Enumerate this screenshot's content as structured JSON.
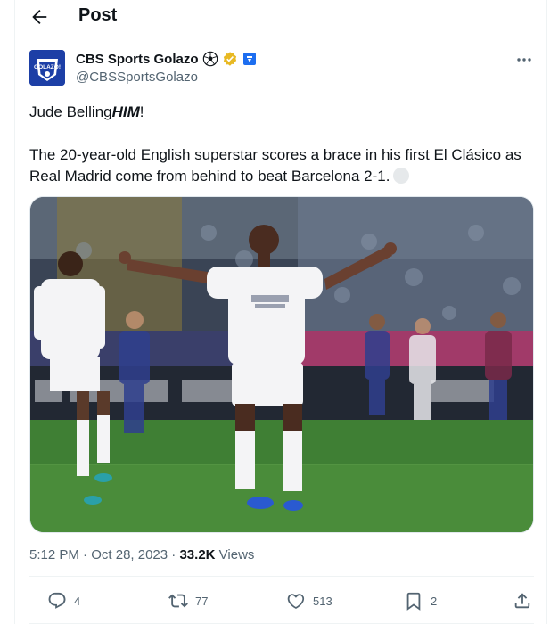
{
  "header": {
    "title": "Post"
  },
  "author": {
    "display_name": "CBS Sports Golazo",
    "handle": "@CBSSportsGolazo",
    "avatar_text": "GOLAZO!"
  },
  "tweet": {
    "text_part1": "Jude Belling",
    "text_part1_emph": "HIM",
    "text_part1_end": "!",
    "text_part2": "The 20-year-old English superstar scores a brace in his first El Clásico as Real Madrid come from behind to beat Barcelona 2-1."
  },
  "meta": {
    "time": "5:12 PM",
    "date": "Oct 28, 2023",
    "views_count": "33.2K",
    "views_label": "Views"
  },
  "actions": {
    "replies": "4",
    "reposts": "77",
    "likes": "513",
    "bookmarks": "2"
  },
  "colors": {
    "verified_gold": "#e8b923",
    "affiliate_blue": "#1d6ef0",
    "secondary_text": "#536471"
  },
  "icons": [
    "back-arrow-icon",
    "more-icon",
    "soccer-ball-icon",
    "verified-badge-icon",
    "affiliate-badge-icon",
    "reply-icon",
    "repost-icon",
    "like-icon",
    "bookmark-icon",
    "share-icon"
  ]
}
